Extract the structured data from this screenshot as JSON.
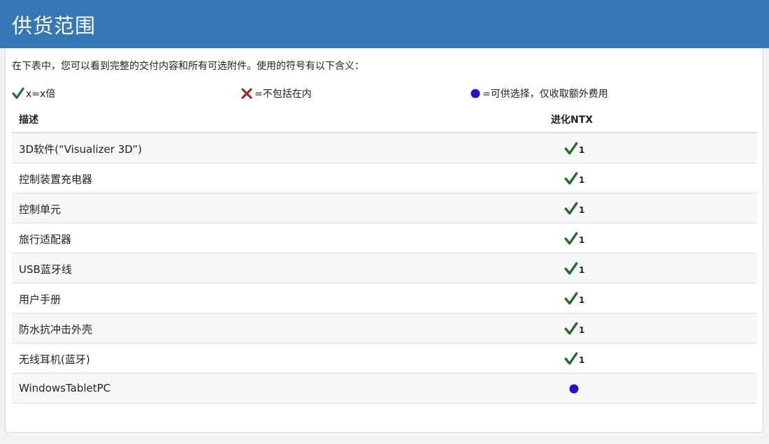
{
  "header": {
    "title": "供货范围"
  },
  "intro": "在下表中，您可以看到完整的交付内容和所有可选附件。使用的符号有以下含义：",
  "legend": {
    "included": "x=x倍",
    "excluded": "=不包括在内",
    "optional": "=可供选择，仅收取额外费用"
  },
  "table": {
    "columns": [
      "描述",
      "进化NTX"
    ],
    "rows": [
      {
        "label": "3D软件(“Visualizer 3D”)",
        "status": "check",
        "qty": "1"
      },
      {
        "label": "控制装置充电器",
        "status": "check",
        "qty": "1"
      },
      {
        "label": "控制单元",
        "status": "check",
        "qty": "1"
      },
      {
        "label": "旅行适配器",
        "status": "check",
        "qty": "1"
      },
      {
        "label": "USB蓝牙线",
        "status": "check",
        "qty": "1"
      },
      {
        "label": "用户手册",
        "status": "check",
        "qty": "1"
      },
      {
        "label": "防水抗冲击外壳",
        "status": "check",
        "qty": "1"
      },
      {
        "label": "无线耳机(蓝牙)",
        "status": "check",
        "qty": "1"
      },
      {
        "label": "WindowsTabletPC",
        "status": "optional",
        "qty": ""
      }
    ]
  },
  "colors": {
    "header_bg": "#3577b5",
    "check": "#1f6b2a",
    "cross": "#a3242a",
    "optional_dot": "#2a12c4"
  }
}
